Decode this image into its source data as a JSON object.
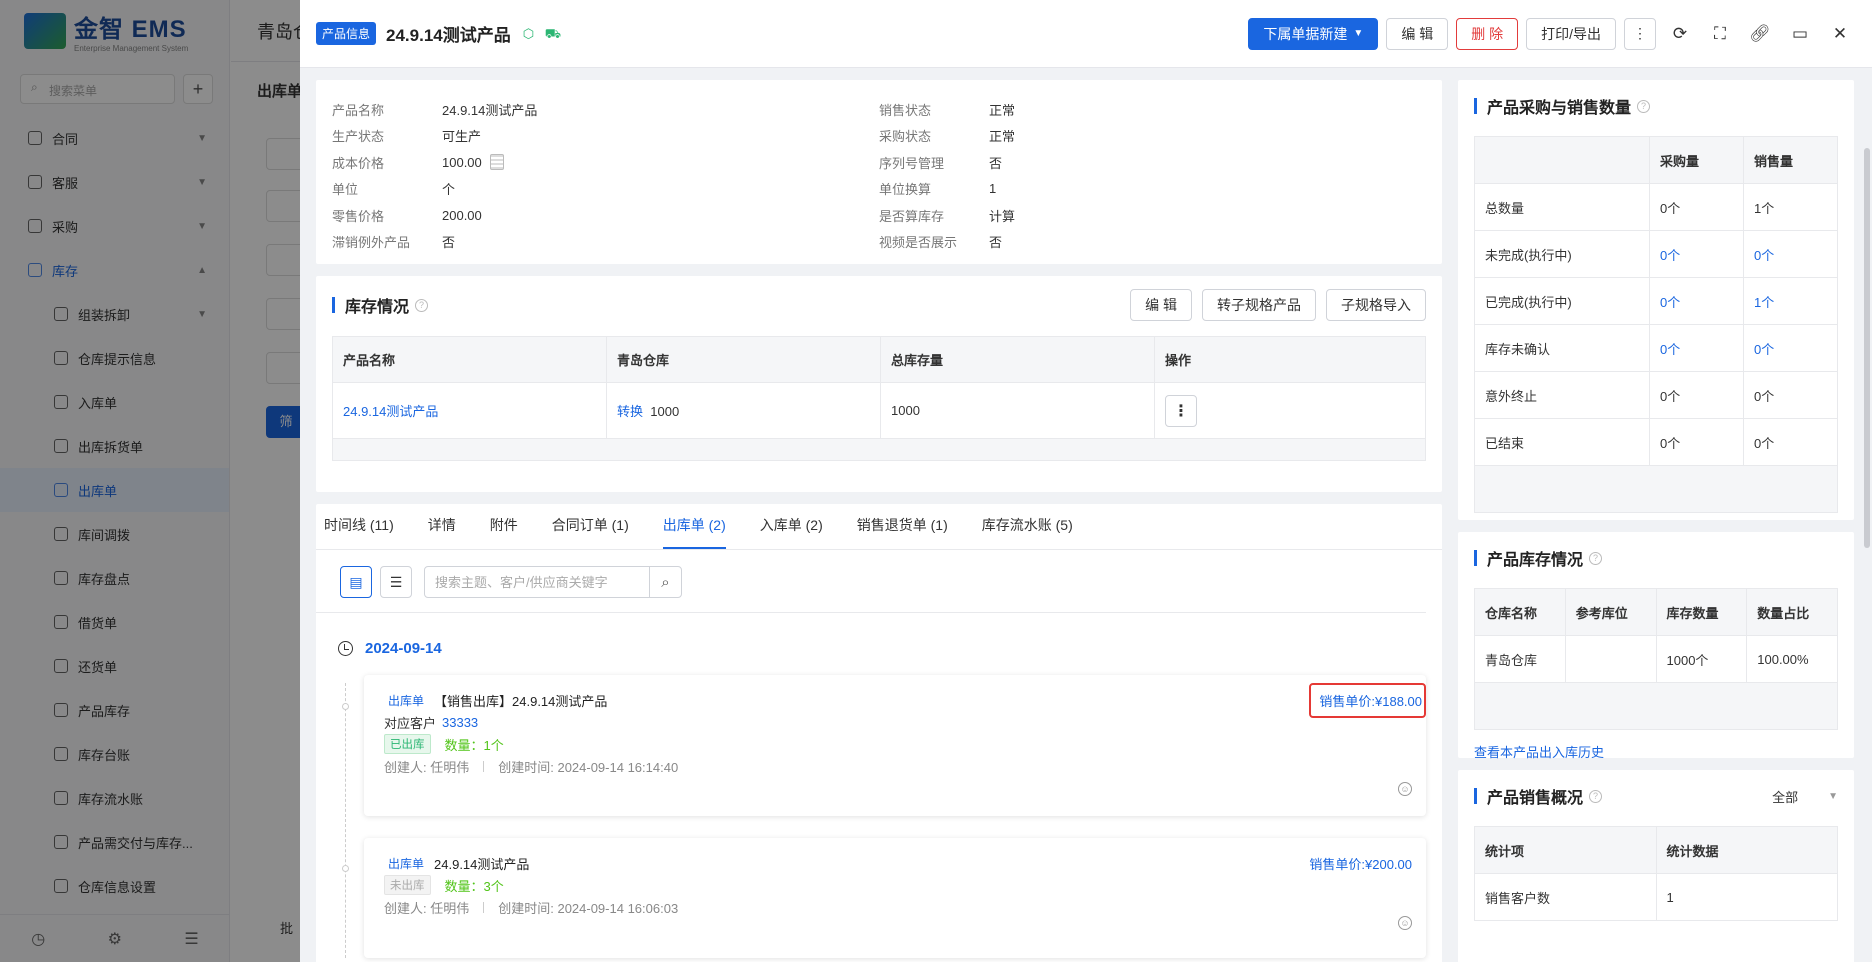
{
  "bg": {
    "logo": "金智 EMS",
    "logo_sub": "Enterprise Management System",
    "search_placeholder": "搜索菜单",
    "topbar_title": "青岛仓",
    "subtitle": "出库单",
    "btn_label": "筛",
    "bottom_text": "批",
    "menu": [
      {
        "label": "合同",
        "type": "group"
      },
      {
        "label": "客服",
        "type": "group"
      },
      {
        "label": "采购",
        "type": "group"
      },
      {
        "label": "库存",
        "type": "group-open"
      },
      {
        "label": "组装拆卸",
        "type": "sub-group"
      },
      {
        "label": "仓库提示信息",
        "type": "sub"
      },
      {
        "label": "入库单",
        "type": "sub"
      },
      {
        "label": "出库拆货单",
        "type": "sub"
      },
      {
        "label": "出库单",
        "type": "sub-active"
      },
      {
        "label": "库间调拨",
        "type": "sub"
      },
      {
        "label": "库存盘点",
        "type": "sub"
      },
      {
        "label": "借货单",
        "type": "sub"
      },
      {
        "label": "还货单",
        "type": "sub"
      },
      {
        "label": "产品库存",
        "type": "sub"
      },
      {
        "label": "库存台账",
        "type": "sub"
      },
      {
        "label": "库存流水账",
        "type": "sub"
      },
      {
        "label": "产品需交付与库存...",
        "type": "sub"
      },
      {
        "label": "仓库信息设置",
        "type": "sub"
      }
    ]
  },
  "header": {
    "tag": "产品信息",
    "title": "24.9.14测试产品",
    "new_btn": "下属单据新建",
    "edit_btn": "编 辑",
    "delete_btn": "删 除",
    "print_btn": "打印/导出"
  },
  "info": {
    "left": [
      {
        "k": "产品名称",
        "v": "24.9.14测试产品"
      },
      {
        "k": "生产状态",
        "v": "可生产"
      },
      {
        "k": "成本价格",
        "v": "100.00",
        "calc": true
      },
      {
        "k": "单位",
        "v": "个"
      },
      {
        "k": "零售价格",
        "v": "200.00"
      },
      {
        "k": "滞销例外产品",
        "v": "否"
      }
    ],
    "right": [
      {
        "k": "销售状态",
        "v": "正常"
      },
      {
        "k": "采购状态",
        "v": "正常"
      },
      {
        "k": "序列号管理",
        "v": "否"
      },
      {
        "k": "单位换算",
        "v": "1"
      },
      {
        "k": "是否算库存",
        "v": "计算"
      },
      {
        "k": "视频是否展示",
        "v": "否"
      }
    ]
  },
  "stock": {
    "title": "库存情况",
    "buttons": [
      "编 辑",
      "转子规格产品",
      "子规格导入"
    ],
    "headers": [
      "产品名称",
      "青岛仓库",
      "总库存量",
      "操作"
    ],
    "row": {
      "name": "24.9.14测试产品",
      "convert": "转换",
      "qty": "1000",
      "total": "1000"
    }
  },
  "tabs": [
    "时间线 (11)",
    "详情",
    "附件",
    "合同订单 (1)",
    "出库单 (2)",
    "入库单 (2)",
    "销售退货单 (1)",
    "库存流水账 (5)"
  ],
  "active_tab": 4,
  "search_placeholder": "搜索主题、客户/供应商关键字",
  "timeline": {
    "date": "2024-09-14",
    "entries": [
      {
        "tag": "出库单",
        "title": "【销售出库】24.9.14测试产品",
        "customer_label": "对应客户",
        "customer": "33333",
        "status": "已出库",
        "qty": "数量：1个",
        "creator": "创建人: 任明伟",
        "time": "创建时间: 2024-09-14 16:14:40",
        "price": "销售单价:¥188.00"
      },
      {
        "tag": "出库单",
        "title": "24.9.14测试产品",
        "status": "未出库",
        "qty": "数量：3个",
        "creator": "创建人: 任明伟",
        "time": "创建时间: 2024-09-14 16:06:03",
        "price": "销售单价:¥200.00"
      }
    ]
  },
  "purchase_sales": {
    "title": "产品采购与销售数量",
    "headers": [
      "",
      "采购量",
      "销售量"
    ],
    "rows": [
      {
        "label": "总数量",
        "p": "0个",
        "s": "1个",
        "link": false
      },
      {
        "label": "未完成(执行中)",
        "p": "0个",
        "s": "0个",
        "link": true
      },
      {
        "label": "已完成(执行中)",
        "p": "0个",
        "s": "1个",
        "link": true
      },
      {
        "label": "库存未确认",
        "p": "0个",
        "s": "0个",
        "link": true
      },
      {
        "label": "意外终止",
        "p": "0个",
        "s": "0个",
        "link": false
      },
      {
        "label": "已结束",
        "p": "0个",
        "s": "0个",
        "link": false
      }
    ]
  },
  "product_stock": {
    "title": "产品库存情况",
    "headers": [
      "仓库名称",
      "参考库位",
      "库存数量",
      "数量占比"
    ],
    "row": [
      "青岛仓库",
      "",
      "1000个",
      "100.00%"
    ],
    "history_link": "查看本产品出入库历史"
  },
  "sales_overview": {
    "title": "产品销售概况",
    "filter": "全部",
    "headers": [
      "统计项",
      "统计数据"
    ],
    "rows": [
      [
        "销售客户数",
        "1"
      ]
    ]
  },
  "colors": {
    "primary": "#1a66e0",
    "danger": "#e23b3b",
    "success": "#2bb673",
    "highlight": "#e53935"
  }
}
